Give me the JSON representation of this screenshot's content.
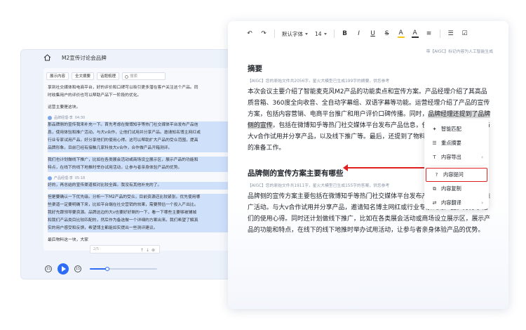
{
  "left_window": {
    "title": "M2宣传讨论会品牌",
    "toolbar": {
      "btn1": "展示内容",
      "btn2": "全文摘要",
      "btn3": "话题梳理",
      "search_placeholder": "搜索"
    },
    "intro_line1": "享到社交媒体和电商平台，好的评价和口碑可以吸引更多潜在客户关注这个产品。同",
    "intro_line2": "时收集用户的评价也可以帮助产品下一阶段的优化。",
    "intro_line3": "运营主要是这块。",
    "speaker1": {
      "name": "品牌经理-李",
      "time": "04:30"
    },
    "s1_lines": [
      "那品牌侧的宣传我来补充一下。首先考虑在微博知乎等热门社交媒体平台发布产品信",
      "息，使用体验和推广活动。与大v合作，让他们试用并分享产品。邀请知名博主网红或",
      "行业专家试用产品，好分享他们的使用心得。这可以帮助扩大产品的受众范围，提高",
      "品牌形象。目前已经有接触几家科技大v合作，合作做产品开箱测评。",
      "",
      "我们也计划做线下推广，比如在各类展会活动或商场设立展示区，展示产品的功能和",
      "特点，在线下的线下地推时举办试用活动，让参与者亲身体验产品的优势。"
    ],
    "speaker2": {
      "name": "产品经理-李",
      "time": "05:18"
    },
    "s2_line1": "好的，再总结的宣传渠道相对比较全面。我没有其他补充的了。",
    "s2_lines": [
      "但是要确认一下优先级。分析一下M2产品的受众，目前资源还比较紧张。优先使用哪",
      "些渠道一定要明确下来，比如平台端在社交营销的效果，需要预估一个投入产出比。",
      "我好先跟领导要资源。品牌这边的大v也要好好剩的一下，看一下哪些主要够被辅城",
      "和我们产品类目比较匹配的，然后作为备选做一个详细的方案出来。我们希望了解真",
      "实的用户感受和反馈，希望博主都能如实提出一些测评建议。"
    ],
    "s3_line": "最后物料这一块，大家",
    "mini_input": "2/5",
    "player": {
      "rewind": "15",
      "forward": "15",
      "progress": 0.26
    }
  },
  "right_window": {
    "toolbar": {
      "undo": "↶",
      "redo": "↷",
      "font": "默认字体",
      "size": "14",
      "bold": "B",
      "italic": "I",
      "underline": "U",
      "strike": "S",
      "highlight": "A",
      "color": "A",
      "align": "≡",
      "list": "☰",
      "check": "☑"
    },
    "aigc_tag": "带【AIGC】标记内容为人工智能生成",
    "section1": {
      "heading": "摘要",
      "meta": "【AIGC】您的原始文件共2056字，星火大模型已生成199字的摘要，供您参考",
      "p_before": "本次会议主要介绍了智能麦克风M2产品的功能卖点和宣传方案。产品经理介绍了其高品质音箱、360度全向收音、全自动字幕组、双语字幕等功能。运营经理介绍了产品的宣传方案，包括内容营销、电商平台推广和用户评价口碑传播。同时，",
      "p_selected": "品牌经理还提到了品牌侧的宣传",
      "p_after": "，包括在微博知乎等热门社交媒体平台发布产品信息，使用体验和推广活动、与大v合作试用并分享产品，以及线下推广等。最后，还提到了物料方面需要做好宣传方案的准备工作。"
    },
    "section2": {
      "heading": "品牌侧的宣传方案主要有哪些",
      "meta": "【AIGC】您的原始文件共1911字，星火大模型已生成155字的答案，供您参考",
      "paragraph": "品牌侧的宣传方案主要包括在微博知乎等热门社交媒体平台发布产品信息，使用体验和推广活动。与大v合作试用并分享产品，邀请知名博主网红或行业专家试用产品，好分享他们的使用心得。同时还计划做线下推广，比如在各类展会活动或商场设立展示区，展示产品的功能和特点，在线下的线下地推时举办试用活动，让参与者亲身体验产品的优势。"
    },
    "context_menu": [
      {
        "icon": "✦",
        "label": "智能匹配",
        "chevron": ""
      },
      {
        "icon": "☰",
        "label": "重点摘要",
        "chevron": ""
      },
      {
        "icon": "T",
        "label": "内容导出",
        "chevron": "›"
      },
      {
        "icon": "?",
        "label": "内容提问",
        "chevron": ""
      },
      {
        "icon": "⧉",
        "label": "内容复制",
        "chevron": ""
      },
      {
        "icon": "⇄",
        "label": "内容翻译",
        "chevron": "›"
      }
    ]
  },
  "colors": {
    "accent": "#2f6cf6",
    "annotation": "#e02020",
    "highlight": "#cfe0fb",
    "selection": "#d9d9d9"
  }
}
